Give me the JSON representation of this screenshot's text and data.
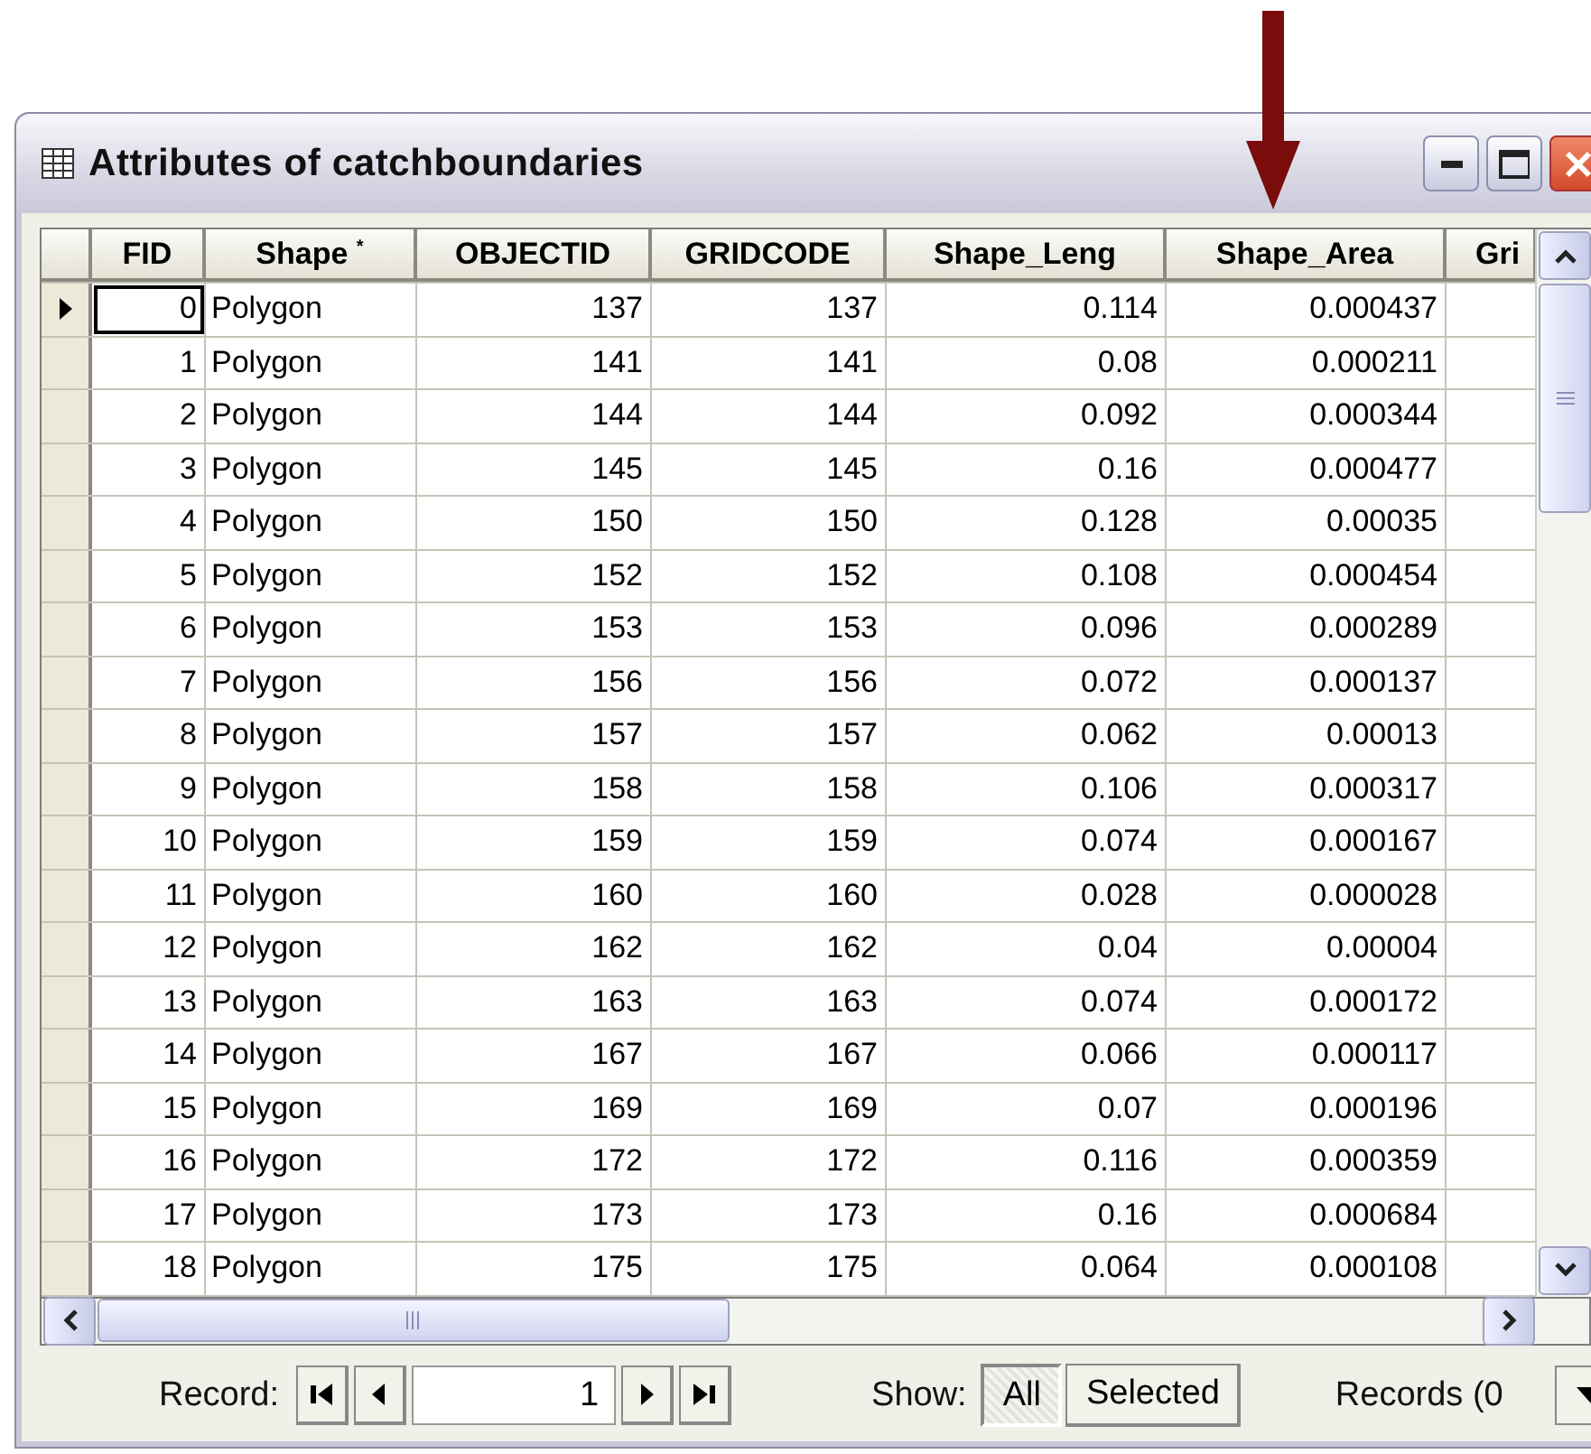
{
  "window": {
    "title": "Attributes of catchboundaries"
  },
  "table": {
    "columns": [
      "FID",
      "Shape $^{*}$",
      "OBJECTID",
      "GRIDCODE",
      "Shape_Leng",
      "Shape_Area",
      "Gri"
    ],
    "rows": [
      {
        "selected": true,
        "cells": [
          "0",
          "Polygon",
          "137",
          "137",
          "0.114",
          "0.000437"
        ]
      },
      {
        "selected": false,
        "cells": [
          "1",
          "Polygon",
          "141",
          "141",
          "0.08",
          "0.000211"
        ]
      },
      {
        "selected": false,
        "cells": [
          "2",
          "Polygon",
          "144",
          "144",
          "0.092",
          "0.000344"
        ]
      },
      {
        "selected": false,
        "cells": [
          "3",
          "Polygon",
          "145",
          "145",
          "0.16",
          "0.000477"
        ]
      },
      {
        "selected": false,
        "cells": [
          "4",
          "Polygon",
          "150",
          "150",
          "0.128",
          "0.00035"
        ]
      },
      {
        "selected": false,
        "cells": [
          "5",
          "Polygon",
          "152",
          "152",
          "0.108",
          "0.000454"
        ]
      },
      {
        "selected": false,
        "cells": [
          "6",
          "Polygon",
          "153",
          "153",
          "0.096",
          "0.000289"
        ]
      },
      {
        "selected": false,
        "cells": [
          "7",
          "Polygon",
          "156",
          "156",
          "0.072",
          "0.000137"
        ]
      },
      {
        "selected": false,
        "cells": [
          "8",
          "Polygon",
          "157",
          "157",
          "0.062",
          "0.00013"
        ]
      },
      {
        "selected": false,
        "cells": [
          "9",
          "Polygon",
          "158",
          "158",
          "0.106",
          "0.000317"
        ]
      },
      {
        "selected": false,
        "cells": [
          "10",
          "Polygon",
          "159",
          "159",
          "0.074",
          "0.000167"
        ]
      },
      {
        "selected": false,
        "cells": [
          "11",
          "Polygon",
          "160",
          "160",
          "0.028",
          "0.000028"
        ]
      },
      {
        "selected": false,
        "cells": [
          "12",
          "Polygon",
          "162",
          "162",
          "0.04",
          "0.00004"
        ]
      },
      {
        "selected": false,
        "cells": [
          "13",
          "Polygon",
          "163",
          "163",
          "0.074",
          "0.000172"
        ]
      },
      {
        "selected": false,
        "cells": [
          "14",
          "Polygon",
          "167",
          "167",
          "0.066",
          "0.000117"
        ]
      },
      {
        "selected": false,
        "cells": [
          "15",
          "Polygon",
          "169",
          "169",
          "0.07",
          "0.000196"
        ]
      },
      {
        "selected": false,
        "cells": [
          "16",
          "Polygon",
          "172",
          "172",
          "0.116",
          "0.000359"
        ]
      },
      {
        "selected": false,
        "cells": [
          "17",
          "Polygon",
          "173",
          "173",
          "0.16",
          "0.000684"
        ]
      },
      {
        "selected": false,
        "cells": [
          "18",
          "Polygon",
          "175",
          "175",
          "0.064",
          "0.000108"
        ]
      }
    ]
  },
  "navigation": {
    "record_label": "Record:",
    "record_value": "1",
    "show_label": "Show:",
    "show_options": [
      {
        "label": "All",
        "selected": true
      },
      {
        "label": "Selected",
        "selected": false
      }
    ],
    "records_text": "Records (0"
  }
}
